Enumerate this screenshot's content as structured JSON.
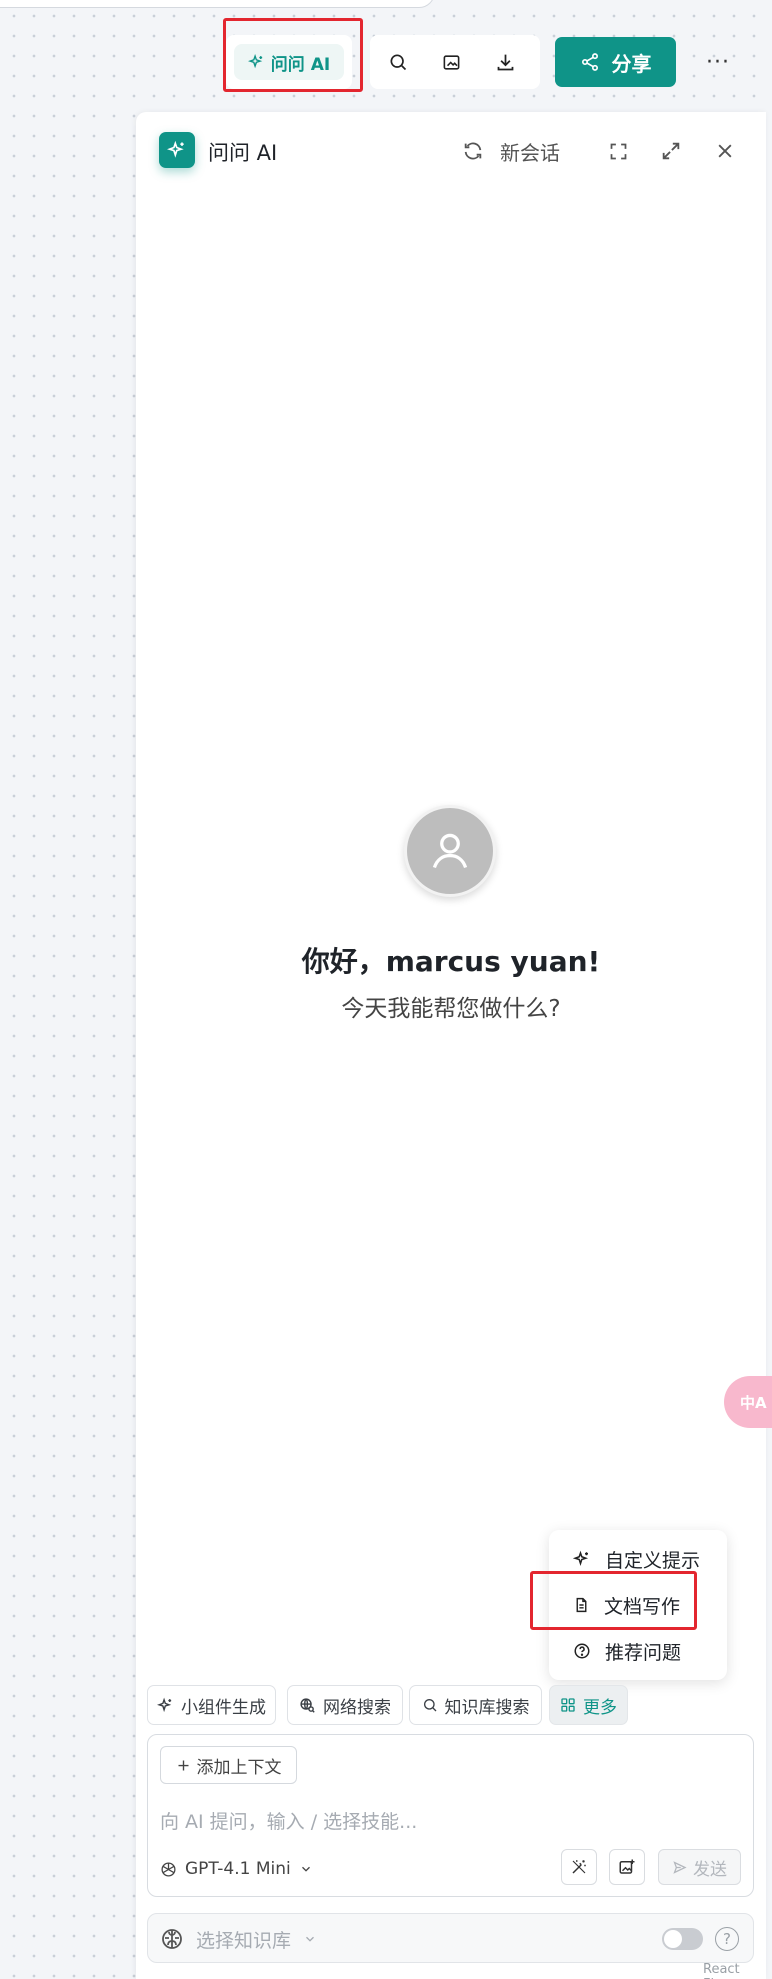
{
  "toolbar": {
    "ask_ai_label": "问问 AI",
    "share_label": "分享",
    "more_label": "···"
  },
  "panel": {
    "title": "问问 AI",
    "new_chat_label": "新会话",
    "greeting": "你好，marcus yuan!",
    "subtitle": "今天我能帮您做什么?"
  },
  "popup_menu": {
    "items": [
      {
        "label": "自定义提示",
        "icon": "sparkle-icon"
      },
      {
        "label": "文档写作",
        "icon": "document-icon"
      },
      {
        "label": "推荐问题",
        "icon": "question-circle-icon"
      }
    ]
  },
  "skills": {
    "chips": [
      {
        "label": "小组件生成",
        "icon": "sparkle-icon"
      },
      {
        "label": "网络搜索",
        "icon": "globe-search-icon"
      },
      {
        "label": "知识库搜索",
        "icon": "search-icon"
      },
      {
        "label": "更多",
        "icon": "grid-icon"
      }
    ]
  },
  "input": {
    "add_context_label": "添加上下文",
    "placeholder": "向 AI 提问，输入 / 选择技能...",
    "model": "GPT-4.1 Mini",
    "send_label": "发送"
  },
  "knowledge": {
    "placeholder": "选择知识库"
  },
  "floating": {
    "translate_label": "中A"
  },
  "footer": {
    "text": "React Flow"
  },
  "colors": {
    "accent": "#0f9488",
    "highlight": "#e3262f"
  }
}
